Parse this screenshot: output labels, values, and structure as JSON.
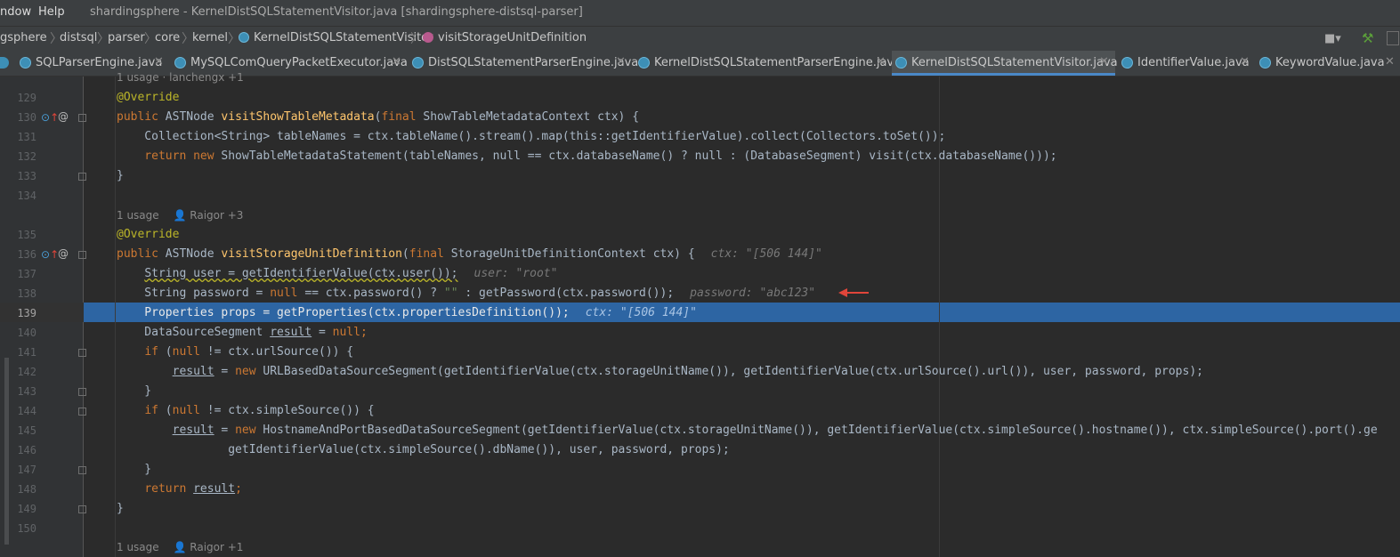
{
  "menu": {
    "window": "ndow",
    "help": "Help",
    "title": "shardingsphere - KernelDistSQLStatementVisitor.java [shardingsphere-distsql-parser]"
  },
  "breadcrumb": [
    "gsphere",
    "distsql",
    "parser",
    "core",
    "kernel",
    "KernelDistSQLStatementVisitor",
    "visitStorageUnitDefinition"
  ],
  "tabs": [
    {
      "label": "SQLParserEngine.java"
    },
    {
      "label": "MySQLComQueryPacketExecutor.java"
    },
    {
      "label": "DistSQLStatementParserEngine.java"
    },
    {
      "label": "KernelDistSQLStatementParserEngine.java"
    },
    {
      "label": "KernelDistSQLStatementVisitor.java",
      "active": true
    },
    {
      "label": "IdentifierValue.java"
    },
    {
      "label": "KeywordValue.java"
    }
  ],
  "colors": {
    "selection": "#2d65a3",
    "active_tab_underline": "#4a88c7",
    "breakpoint_arrow": "#e0453a"
  },
  "meta": {
    "top": "1 usage  ·  lanchengx +1",
    "m1": "1 usage",
    "m1_author": "Raigor +3",
    "m2": "1 usage",
    "m2_author": "Raigor +1"
  },
  "lines": {
    "l129": "129",
    "l130": "130",
    "l131": "131",
    "l132": "132",
    "l133": "133",
    "l134": "134",
    "l135": "135",
    "l136": "136",
    "l137": "137",
    "l138": "138",
    "l139": "139",
    "l140": "140",
    "l141": "141",
    "l142": "142",
    "l143": "143",
    "l144": "144",
    "l145": "145",
    "l146": "146",
    "l147": "147",
    "l148": "148",
    "l149": "149",
    "l150": "150"
  },
  "code": {
    "c129": "@Override",
    "c130a": "public",
    "c130b": " ASTNode ",
    "c130c": "visitShowTableMetadata",
    "c130d": "(",
    "c130e": "final",
    "c130f": " ShowTableMetadataContext ctx) {",
    "c131": "    Collection<String> tableNames = ctx.tableName().stream().map(this::getIdentifierValue).collect(Collectors.toSet());",
    "c132a": "    return new ",
    "c132b": "ShowTableMetadataStatement(tableNames, null == ctx.databaseName() ? null : (DatabaseSegment) visit(ctx.databaseName()));",
    "c133": "}",
    "c135": "@Override",
    "c136a": "public",
    "c136b": " ASTNode ",
    "c136c": "visitStorageUnitDefinition",
    "c136d": "(",
    "c136e": "final",
    "c136f": " StorageUnitDefinitionContext ctx) {",
    "c136h": "ctx: \"[506 144]\"",
    "c137a": "    ",
    "c137b": "String user = getIdentifierValue(ctx.user());",
    "c137h": "user: \"root\"",
    "c138a": "    String password = ",
    "c138b": "null",
    "c138c": " == ctx.password() ? ",
    "c138d": "\"\"",
    "c138e": " : getPassword(ctx.password());",
    "c138h": "password: \"abc123\"",
    "c139": "    Properties props = getProperties(ctx.propertiesDefinition());",
    "c139h": "ctx: \"[506 144]\"",
    "c140a": "    DataSourceSegment ",
    "c140b": "result",
    "c140c": " = ",
    "c140d": "null",
    "c140e": ";",
    "c141a": "    ",
    "c141b": "if",
    "c141c": " (",
    "c141d": "null",
    "c141e": " != ctx.urlSource()) {",
    "c142a": "        ",
    "c142b": "result",
    "c142c": " = ",
    "c142d": "new",
    "c142e": " URLBasedDataSourceSegment(getIdentifierValue(ctx.storageUnitName()), getIdentifierValue(ctx.urlSource().url()), user, password, props);",
    "c143": "    }",
    "c144a": "    ",
    "c144b": "if",
    "c144c": " (",
    "c144d": "null",
    "c144e": " != ctx.simpleSource()) {",
    "c145a": "        ",
    "c145b": "result",
    "c145c": " = ",
    "c145d": "new",
    "c145e": " HostnameAndPortBasedDataSourceSegment(getIdentifierValue(ctx.storageUnitName()), getIdentifierValue(ctx.simpleSource().hostname()), ctx.simpleSource().port().ge",
    "c146": "                getIdentifierValue(ctx.simpleSource().dbName()), user, password, props);",
    "c147": "    }",
    "c148a": "    ",
    "c148b": "return",
    "c148c": " ",
    "c148d": "result",
    "c148e": ";",
    "c149": "}"
  }
}
